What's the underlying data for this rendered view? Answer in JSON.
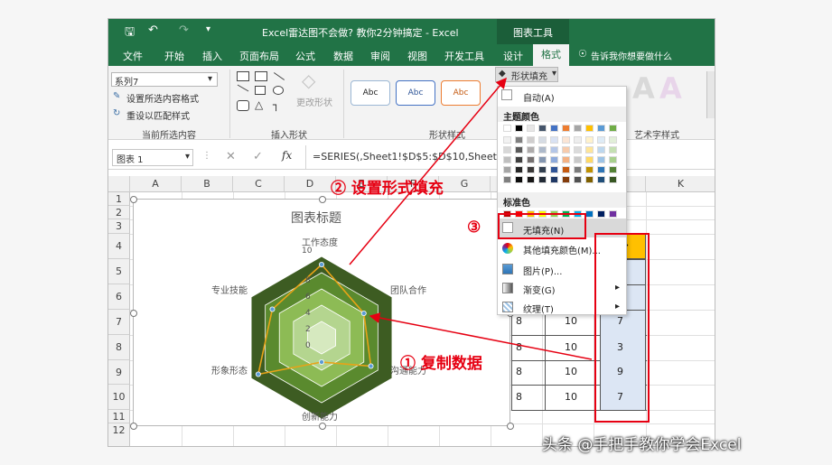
{
  "window": {
    "title": "Excel雷达图不会做? 教你2分钟搞定 - Excel",
    "context_tab": "图表工具"
  },
  "ribbon": {
    "tabs": [
      "文件",
      "开始",
      "插入",
      "页面布局",
      "公式",
      "数据",
      "审阅",
      "视图",
      "开发工具",
      "设计",
      "格式"
    ],
    "tell_me": "告诉我你想要做什么",
    "selection_box": "系列7",
    "format_selection": "设置所选内容格式",
    "reset_style": "重设以匹配样式",
    "group_current": "当前所选内容",
    "group_insert_shape": "插入形状",
    "change_shape": "更改形状",
    "group_shape_styles": "形状样式",
    "style_sample": "Abc",
    "shape_fill": "形状填充",
    "group_art": "艺术字样式",
    "wordart_letter": "A"
  },
  "formula_bar": {
    "name_box": "图表 1",
    "fx": "fx",
    "formula": "=SERIES(,Sheet1!$D$5:$D$10,Sheet1!$J"
  },
  "grid": {
    "columns": [
      "A",
      "B",
      "C",
      "D",
      "E",
      "F",
      "G",
      "H",
      "I",
      "J",
      "K"
    ],
    "rows": [
      "1",
      "2",
      "3",
      "4",
      "5",
      "6",
      "7",
      "8",
      "9",
      "10",
      "11",
      "12"
    ],
    "table_header_partial": "分",
    "table_rows": [
      {
        "c1": "8",
        "c2": "10",
        "c3": "7"
      },
      {
        "c1": "8",
        "c2": "10",
        "c3": "3"
      },
      {
        "c1": "8",
        "c2": "10",
        "c3": "9"
      },
      {
        "c1": "8",
        "c2": "10",
        "c3": "7"
      }
    ]
  },
  "chart": {
    "title": "图表标题",
    "axes": [
      "工作态度",
      "团队合作",
      "沟通能力",
      "创新能力",
      "形象形态",
      "专业技能"
    ],
    "ticks": [
      "10",
      "8",
      "6",
      "4",
      "2",
      "0"
    ]
  },
  "chart_data": {
    "type": "radar",
    "title": "图表标题",
    "categories": [
      "工作态度",
      "团队合作",
      "沟通能力",
      "创新能力",
      "形象形态",
      "专业技能"
    ],
    "ylim": [
      0,
      10
    ],
    "series": [
      {
        "values": [
          10,
          10,
          10,
          10,
          10,
          10
        ],
        "color": "#3d5c22"
      },
      {
        "values": [
          8,
          8,
          8,
          8,
          8,
          8
        ],
        "color": "#5a8a2e"
      },
      {
        "values": [
          6,
          6,
          6,
          6,
          6,
          6
        ],
        "color": "#8dbb55"
      },
      {
        "values": [
          4,
          4,
          4,
          4,
          4,
          4
        ],
        "color": "#b4d58f"
      },
      {
        "values": [
          2,
          2,
          2,
          2,
          2,
          2
        ],
        "color": "#d6e9bf"
      },
      {
        "values": [
          9,
          6,
          7,
          3,
          9,
          7
        ],
        "color": "#e8a317"
      }
    ]
  },
  "dropdown": {
    "auto": "自动(A)",
    "theme_colors": "主题颜色",
    "standard_colors": "标准色",
    "no_fill": "无填充(N)",
    "more_colors": "其他填充颜色(M)...",
    "picture": "图片(P)...",
    "gradient": "渐变(G)",
    "texture": "纹理(T)"
  },
  "annotations": {
    "step1": "① 复制数据",
    "step2": "② 设置形式填充",
    "step3": "③",
    "watermark": "头条 @手把手教你学会Excel"
  },
  "colors": {
    "excel_green": "#217346",
    "annotation_red": "#e60012",
    "selection_blue": "#dce6f4",
    "header_yellow": "#ffc000"
  }
}
